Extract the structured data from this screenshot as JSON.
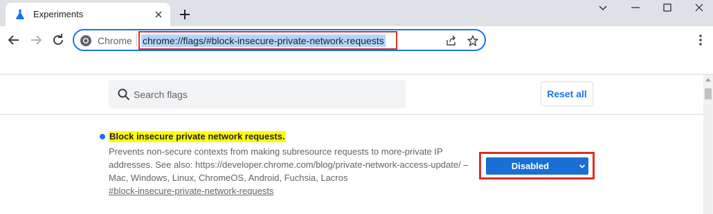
{
  "tab": {
    "title": "Experiments",
    "favicon": "flask-icon"
  },
  "toolbar": {
    "chrome_label": "Chrome",
    "url": "chrome://flags/#block-insecure-private-network-requests"
  },
  "flags_page": {
    "search_placeholder": "Search flags",
    "reset_label": "Reset all"
  },
  "flag": {
    "title": "Block insecure private network requests.",
    "description": "Prevents non-secure contexts from making subresource requests to more-private IP addresses. See also: https://developer.chrome.com/blog/private-network-access-update/ – Mac, Windows, Linux, ChromeOS, Android, Fuchsia, Lacros",
    "anchor": "#block-insecure-private-network-requests",
    "selected_option": "Disabled"
  },
  "colors": {
    "accent": "#1a73e8",
    "highlight_outline": "#d93025",
    "title_highlight": "#ffff00",
    "select_bg": "#1a6fd4"
  }
}
